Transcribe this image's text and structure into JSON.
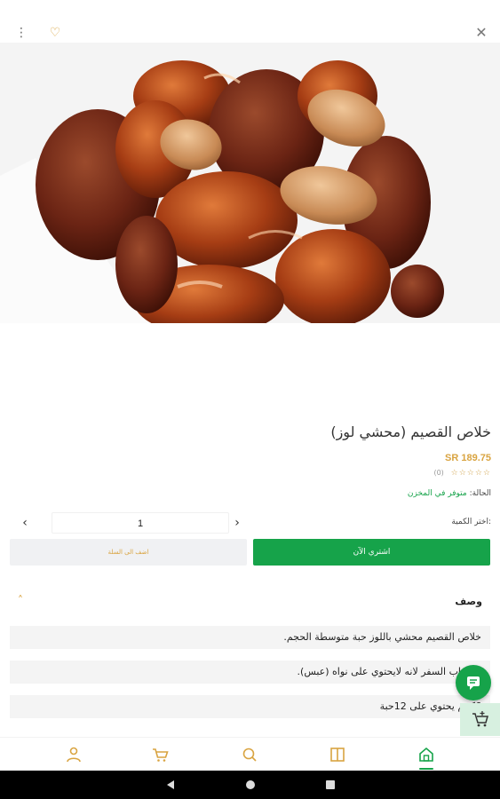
{
  "topbar": {
    "close_icon": "close-icon",
    "favorite_icon": "heart-icon",
    "more_icon": "more-vert-icon"
  },
  "product": {
    "title": "خلاص القصيم (محشي لوز)",
    "price": "SR 189.75",
    "stars": "☆☆☆☆☆",
    "review_count": "(0)",
    "stock_label": "الحالة:",
    "stock_value": "متوفر في المخزن"
  },
  "quantity": {
    "label": "اختر الكمية:",
    "value": "1"
  },
  "actions": {
    "buy_now": "اشتري الآن",
    "add_to_cart": "اضف الى السلة"
  },
  "description": {
    "title": "وصف",
    "lines": [
      "خلاص القصيم محشي باللوز حبة متوسطة الحجم.",
      "لأصحاب السفر لانه لايحتوي على نواه (عبس).",
      "6كجم يحتوي على 12حبة"
    ]
  },
  "bottom_nav": {
    "items": [
      "account-icon",
      "cart-icon",
      "search-icon",
      "book-icon",
      "home-icon"
    ],
    "active": "home-icon"
  },
  "colors": {
    "primary_green": "#16a34a",
    "accent_gold": "#d9a441"
  }
}
